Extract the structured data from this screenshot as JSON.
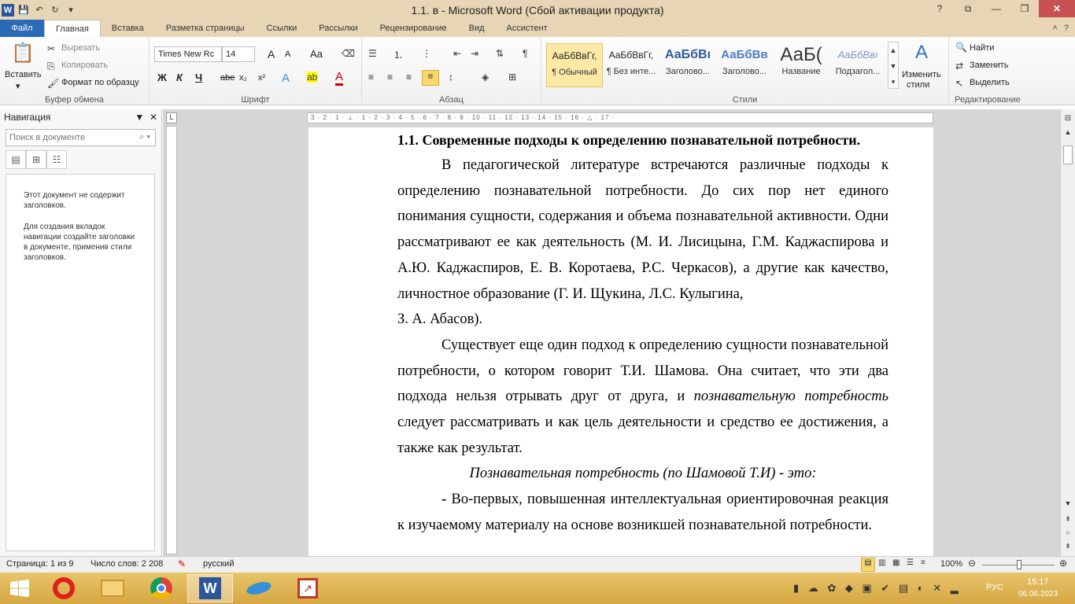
{
  "title": "1.1. в  -  Microsoft Word (Сбой активации продукта)",
  "tabs": {
    "file": "Файл",
    "home": "Главная",
    "insert": "Вставка",
    "layout": "Разметка страницы",
    "refs": "Ссылки",
    "mail": "Рассылки",
    "review": "Рецензирование",
    "view": "Вид",
    "assistant": "Ассистент"
  },
  "clipboard": {
    "paste": "Вставить",
    "cut": "Вырезать",
    "copy": "Копировать",
    "format_painter": "Формат по образцу",
    "label": "Буфер обмена"
  },
  "font": {
    "name": "Times New Rc",
    "size": "14",
    "label": "Шрифт",
    "bold": "Ж",
    "italic": "К",
    "underline": "Ч",
    "strike": "abe",
    "sub": "x₂",
    "sup": "x²",
    "grow": "A",
    "shrink": "A",
    "case": "Aa",
    "color_letter": "A"
  },
  "paragraph": {
    "label": "Абзац"
  },
  "styles": {
    "label": "Стили",
    "items": [
      {
        "preview": "АаБбВвГг,",
        "name": "¶ Обычный"
      },
      {
        "preview": "АаБбВвГг,",
        "name": "¶ Без инте..."
      },
      {
        "preview": "АаБбВı",
        "name": "Заголово..."
      },
      {
        "preview": "АаБбВв",
        "name": "Заголово..."
      },
      {
        "preview": "АаБ(",
        "name": "Название"
      },
      {
        "preview": "АаБбВвı",
        "name": "Подзагол..."
      }
    ],
    "change": "Изменить",
    "change2": "стили"
  },
  "editing": {
    "label": "Редактирование",
    "find": "Найти",
    "replace": "Заменить",
    "select": "Выделить"
  },
  "nav": {
    "title": "Навигация",
    "search_placeholder": "Поиск в документе",
    "msg1": "Этот документ не содержит заголовков.",
    "msg2": "Для создания вкладок навигации создайте заголовки в документе, применив стили заголовков."
  },
  "ruler": {
    "ticks": "3 · 2 · 1 · ⊥ · 1 · 2 · 3 · 4 · 5 · 6 · 7 · 8 · 9 · 10 · 11 · 12 · 13 · 14 · 15 · 16 · △ · 17 ·"
  },
  "doc": {
    "heading": "1.1. Современные подходы к определению познавательной потребности.",
    "p1": "В педагогической литературе встречаются различные подходы к определению познавательной потребности. До сих пор нет единого понимания сущности, содержания и объема познавательной активности. Одни рассматривают ее как деятельность (М. И. Лисицына, Г.М. Каджаспирова и А.Ю. Каджаспиров, Е. В. Коротаева, Р.С. Черкасов), а другие как качество, личностное образование (Г. И. Щукина, Л.С. Кулыгина,",
    "p1_end": " З. А. Абасов).",
    "p2_a": "Существует еще один подход к определению сущности познавательной потребности, о котором говорит Т.И. Шамова. Она считает, что эти два подхода нельзя отрывать друг от друга, и ",
    "p2_italic": "познавательную потребность",
    "p2_b": " следует рассматривать и как цель деятельности и средство ее достижения, а также как результат.",
    "p3": "Познавательная потребность (по Шамовой Т.И)  - это:",
    "p4_dash": "-",
    "p4": " Во-первых, повышенная интеллектуальная ориентировочная реакция к изучаемому материалу на основе возникшей познавательной потребности."
  },
  "status": {
    "page": "Страница: 1 из 9",
    "words": "Число слов: 2 208",
    "lang": "русский",
    "zoom": "100%"
  },
  "tray": {
    "lang": "РУС",
    "time": "15:17",
    "date": "06.06.2023"
  },
  "colors": {
    "accent": "#2b6ab7",
    "titlebar": "#e8d5b5",
    "taskbar": "#d5a743"
  }
}
